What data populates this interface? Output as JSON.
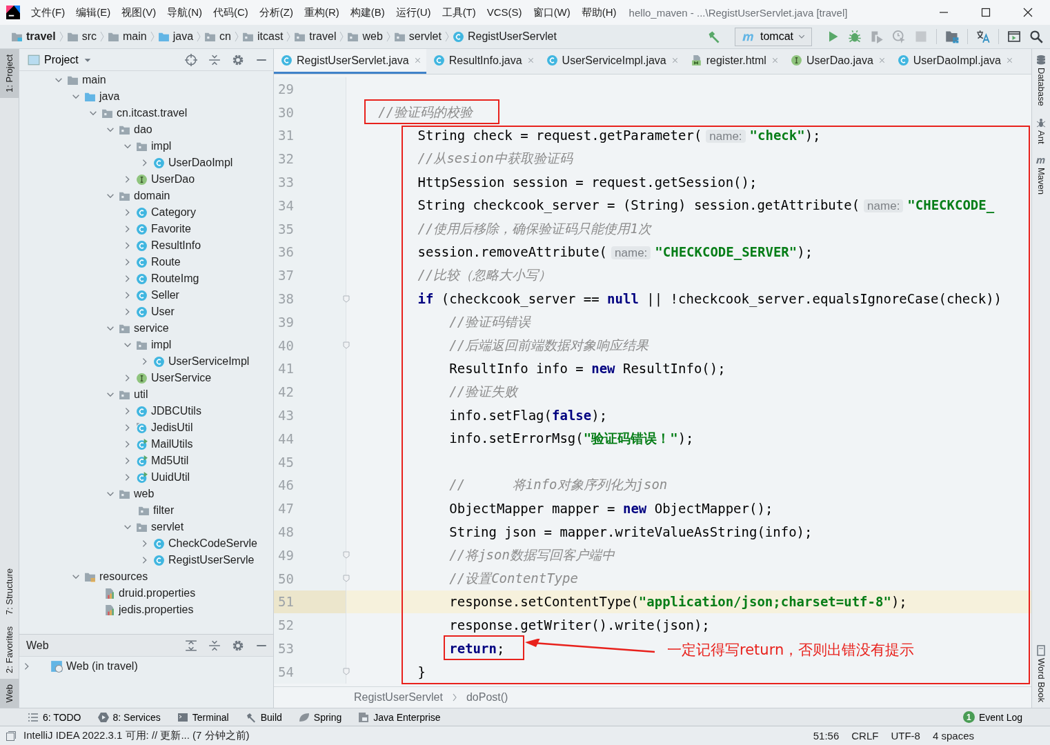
{
  "window": {
    "title": "hello_maven - ...\\RegistUserServlet.java [travel]"
  },
  "menu": [
    "文件(F)",
    "编辑(E)",
    "视图(V)",
    "导航(N)",
    "代码(C)",
    "分析(Z)",
    "重构(R)",
    "构建(B)",
    "运行(U)",
    "工具(T)",
    "VCS(S)",
    "窗口(W)",
    "帮助(H)"
  ],
  "breadcrumbs": [
    {
      "label": "travel",
      "kind": "project"
    },
    {
      "label": "src",
      "kind": "folder"
    },
    {
      "label": "main",
      "kind": "folder"
    },
    {
      "label": "java",
      "kind": "source"
    },
    {
      "label": "cn",
      "kind": "package"
    },
    {
      "label": "itcast",
      "kind": "package"
    },
    {
      "label": "travel",
      "kind": "package"
    },
    {
      "label": "web",
      "kind": "package"
    },
    {
      "label": "servlet",
      "kind": "package"
    },
    {
      "label": "RegistUserServlet",
      "kind": "class"
    }
  ],
  "run_config": {
    "label": "tomcat"
  },
  "left_strip": [
    {
      "label": "1: Project",
      "selected": true
    },
    {
      "label": "7: Structure",
      "selected": false
    },
    {
      "label": "2: Favorites",
      "selected": false
    },
    {
      "label": "Web",
      "selected": true
    }
  ],
  "right_strip": [
    {
      "label": "Database",
      "kind": "database"
    },
    {
      "label": "Ant",
      "kind": "ant"
    },
    {
      "label": "Maven",
      "kind": "maven"
    },
    {
      "label": "Word Book",
      "kind": "book"
    }
  ],
  "project_panel": {
    "title": "Project",
    "tree": [
      {
        "label": "main",
        "kind": "folder",
        "expanded": true,
        "children": [
          {
            "label": "java",
            "kind": "source",
            "expanded": true,
            "children": [
              {
                "label": "cn.itcast.travel",
                "kind": "package",
                "expanded": true,
                "children": [
                  {
                    "label": "dao",
                    "kind": "package",
                    "expanded": true,
                    "children": [
                      {
                        "label": "impl",
                        "kind": "package",
                        "expanded": true,
                        "children": [
                          {
                            "label": "UserDaoImpl",
                            "kind": "class",
                            "expanded": false
                          }
                        ]
                      },
                      {
                        "label": "UserDao",
                        "kind": "interface",
                        "expanded": false
                      }
                    ]
                  },
                  {
                    "label": "domain",
                    "kind": "package",
                    "expanded": true,
                    "children": [
                      {
                        "label": "Category",
                        "kind": "class",
                        "expanded": false
                      },
                      {
                        "label": "Favorite",
                        "kind": "class",
                        "expanded": false
                      },
                      {
                        "label": "ResultInfo",
                        "kind": "class",
                        "expanded": false
                      },
                      {
                        "label": "Route",
                        "kind": "class",
                        "expanded": false
                      },
                      {
                        "label": "RouteImg",
                        "kind": "class",
                        "expanded": false
                      },
                      {
                        "label": "Seller",
                        "kind": "class",
                        "expanded": false
                      },
                      {
                        "label": "User",
                        "kind": "class",
                        "expanded": false
                      }
                    ]
                  },
                  {
                    "label": "service",
                    "kind": "package",
                    "expanded": true,
                    "children": [
                      {
                        "label": "impl",
                        "kind": "package",
                        "expanded": true,
                        "children": [
                          {
                            "label": "UserServiceImpl",
                            "kind": "class",
                            "expanded": false
                          }
                        ]
                      },
                      {
                        "label": "UserService",
                        "kind": "interface",
                        "expanded": false
                      }
                    ]
                  },
                  {
                    "label": "util",
                    "kind": "package",
                    "expanded": true,
                    "children": [
                      {
                        "label": "JDBCUtils",
                        "kind": "class",
                        "expanded": false
                      },
                      {
                        "label": "JedisUtil",
                        "kind": "marked",
                        "expanded": false
                      },
                      {
                        "label": "MailUtils",
                        "kind": "runnable",
                        "expanded": false
                      },
                      {
                        "label": "Md5Util",
                        "kind": "runnable",
                        "expanded": false
                      },
                      {
                        "label": "UuidUtil",
                        "kind": "runnable",
                        "expanded": false
                      }
                    ]
                  },
                  {
                    "label": "web",
                    "kind": "package",
                    "expanded": true,
                    "children": [
                      {
                        "label": "filter",
                        "kind": "package"
                      },
                      {
                        "label": "servlet",
                        "kind": "package",
                        "expanded": true,
                        "children": [
                          {
                            "label": "CheckCodeServle",
                            "kind": "class",
                            "expanded": false
                          },
                          {
                            "label": "RegistUserServle",
                            "kind": "class",
                            "expanded": false
                          }
                        ]
                      }
                    ]
                  }
                ]
              }
            ]
          },
          {
            "label": "resources",
            "kind": "resources",
            "expanded": true,
            "children": [
              {
                "label": "druid.properties",
                "kind": "properties"
              },
              {
                "label": "jedis.properties",
                "kind": "properties"
              }
            ]
          }
        ]
      }
    ]
  },
  "web_panel": {
    "title": "Web",
    "items": [
      {
        "label": "Web (in travel)",
        "expanded": false
      }
    ]
  },
  "tabs": [
    {
      "label": "RegistUserServlet.java",
      "kind": "class",
      "selected": true
    },
    {
      "label": "ResultInfo.java",
      "kind": "class",
      "selected": false
    },
    {
      "label": "UserServiceImpl.java",
      "kind": "class",
      "selected": false
    },
    {
      "label": "register.html",
      "kind": "html",
      "selected": false
    },
    {
      "label": "UserDao.java",
      "kind": "interface",
      "selected": false
    },
    {
      "label": "UserDaoImpl.java",
      "kind": "class",
      "selected": false
    }
  ],
  "code": [
    {
      "number": "29",
      "current": false,
      "fold": false
    },
    {
      "number": "30",
      "current": false,
      "fold": false,
      "tokens": [
        {
          "kind": "comment",
          "text": "   //验证码的校验"
        }
      ]
    },
    {
      "number": "31",
      "current": false,
      "fold": false,
      "tokens": [
        {
          "kind": "plain",
          "text": "        String check = request.getParameter("
        },
        {
          "kind": "hint",
          "text": "name:"
        },
        {
          "kind": "string",
          "text": "\"check\""
        },
        {
          "kind": "plain",
          "text": ");"
        }
      ]
    },
    {
      "number": "32",
      "current": false,
      "fold": false,
      "tokens": [
        {
          "kind": "comment",
          "text": "        //从sesion中获取验证码"
        }
      ]
    },
    {
      "number": "33",
      "current": false,
      "fold": false,
      "tokens": [
        {
          "kind": "plain",
          "text": "        HttpSession session = request.getSession();"
        }
      ]
    },
    {
      "number": "34",
      "current": false,
      "fold": false,
      "tokens": [
        {
          "kind": "plain",
          "text": "        String checkcook_server = (String) session.getAttribute("
        },
        {
          "kind": "hint",
          "text": "name:"
        },
        {
          "kind": "string",
          "text": "\"CHECKCODE_"
        }
      ]
    },
    {
      "number": "35",
      "current": false,
      "fold": false,
      "tokens": [
        {
          "kind": "comment",
          "text": "        //使用后移除，确保验证码只能使用1次"
        }
      ]
    },
    {
      "number": "36",
      "current": false,
      "fold": false,
      "tokens": [
        {
          "kind": "plain",
          "text": "        session.removeAttribute("
        },
        {
          "kind": "hint",
          "text": "name:"
        },
        {
          "kind": "string",
          "text": "\"CHECKCODE_SERVER\""
        },
        {
          "kind": "plain",
          "text": ");"
        }
      ]
    },
    {
      "number": "37",
      "current": false,
      "fold": false,
      "tokens": [
        {
          "kind": "comment",
          "text": "        //比较（忽略大小写）"
        }
      ]
    },
    {
      "number": "38",
      "current": false,
      "fold": true,
      "tokens": [
        {
          "kind": "keyword",
          "text": "        if"
        },
        {
          "kind": "plain",
          "text": " (checkcook_server == "
        },
        {
          "kind": "keyword",
          "text": "null"
        },
        {
          "kind": "plain",
          "text": " || !checkcook_server.equalsIgnoreCase(check))"
        }
      ]
    },
    {
      "number": "39",
      "current": false,
      "fold": false,
      "tokens": [
        {
          "kind": "comment",
          "text": "            //验证码错误"
        }
      ]
    },
    {
      "number": "40",
      "current": false,
      "fold": true,
      "tokens": [
        {
          "kind": "comment",
          "text": "            //后端返回前端数据对象响应结果"
        }
      ]
    },
    {
      "number": "41",
      "current": false,
      "fold": false,
      "tokens": [
        {
          "kind": "plain",
          "text": "            ResultInfo info = "
        },
        {
          "kind": "keyword",
          "text": "new"
        },
        {
          "kind": "plain",
          "text": " ResultInfo();"
        }
      ]
    },
    {
      "number": "42",
      "current": false,
      "fold": false,
      "tokens": [
        {
          "kind": "comment",
          "text": "            //验证失败"
        }
      ]
    },
    {
      "number": "43",
      "current": false,
      "fold": false,
      "tokens": [
        {
          "kind": "plain",
          "text": "            info.setFlag("
        },
        {
          "kind": "keyword",
          "text": "false"
        },
        {
          "kind": "plain",
          "text": ");"
        }
      ]
    },
    {
      "number": "44",
      "current": false,
      "fold": false,
      "tokens": [
        {
          "kind": "plain",
          "text": "            info.setErrorMsg("
        },
        {
          "kind": "string",
          "text": "\"验证码错误！\""
        },
        {
          "kind": "plain",
          "text": ");"
        }
      ]
    },
    {
      "number": "45",
      "current": false,
      "fold": false
    },
    {
      "number": "46",
      "current": false,
      "fold": false,
      "tokens": [
        {
          "kind": "comment",
          "text": "            //      将info对象序列化为json"
        }
      ]
    },
    {
      "number": "47",
      "current": false,
      "fold": false,
      "tokens": [
        {
          "kind": "plain",
          "text": "            ObjectMapper mapper = "
        },
        {
          "kind": "keyword",
          "text": "new"
        },
        {
          "kind": "plain",
          "text": " ObjectMapper();"
        }
      ]
    },
    {
      "number": "48",
      "current": false,
      "fold": false,
      "tokens": [
        {
          "kind": "plain",
          "text": "            String json = mapper.writeValueAsString(info);"
        }
      ]
    },
    {
      "number": "49",
      "current": false,
      "fold": true,
      "tokens": [
        {
          "kind": "comment",
          "text": "            //将json数据写回客户端中"
        }
      ]
    },
    {
      "number": "50",
      "current": false,
      "fold": true,
      "tokens": [
        {
          "kind": "comment",
          "text": "            //设置ContentType"
        }
      ]
    },
    {
      "number": "51",
      "current": true,
      "fold": false,
      "tokens": [
        {
          "kind": "plain",
          "text": "            response.setContentType("
        },
        {
          "kind": "string",
          "text": "\"application/json;charset=utf-8\""
        },
        {
          "kind": "plain",
          "text": ");"
        }
      ]
    },
    {
      "number": "52",
      "current": false,
      "fold": false,
      "tokens": [
        {
          "kind": "plain",
          "text": "            response.getWriter().write(json);"
        }
      ]
    },
    {
      "number": "53",
      "current": false,
      "fold": false,
      "tokens": [
        {
          "kind": "keyword",
          "text": "            return"
        },
        {
          "kind": "plain",
          "text": ";"
        }
      ]
    },
    {
      "number": "54",
      "current": false,
      "fold": true,
      "tokens": [
        {
          "kind": "plain",
          "text": "        }"
        }
      ]
    }
  ],
  "annotation": {
    "note": "一定记得写return，否则出错没有提示"
  },
  "editor_breadcrumbs": [
    "RegistUserServlet",
    "doPost()"
  ],
  "tool_windows": [
    {
      "label": "6: TODO",
      "kind": "list"
    },
    {
      "label": "8: Services",
      "kind": "services"
    },
    {
      "label": "Terminal",
      "kind": "terminal"
    },
    {
      "label": "Build",
      "kind": "hammer"
    },
    {
      "label": "Spring",
      "kind": "leaf"
    },
    {
      "label": "Java Enterprise",
      "kind": "enterprise"
    }
  ],
  "event_log": {
    "badge": "1",
    "label": "Event Log"
  },
  "status_bar": {
    "message": "IntelliJ IDEA 2022.3.1 可用: // 更新... (7 分钟之前)",
    "items": [
      "51:56",
      "CRLF",
      "UTF-8",
      "4 spaces"
    ]
  }
}
